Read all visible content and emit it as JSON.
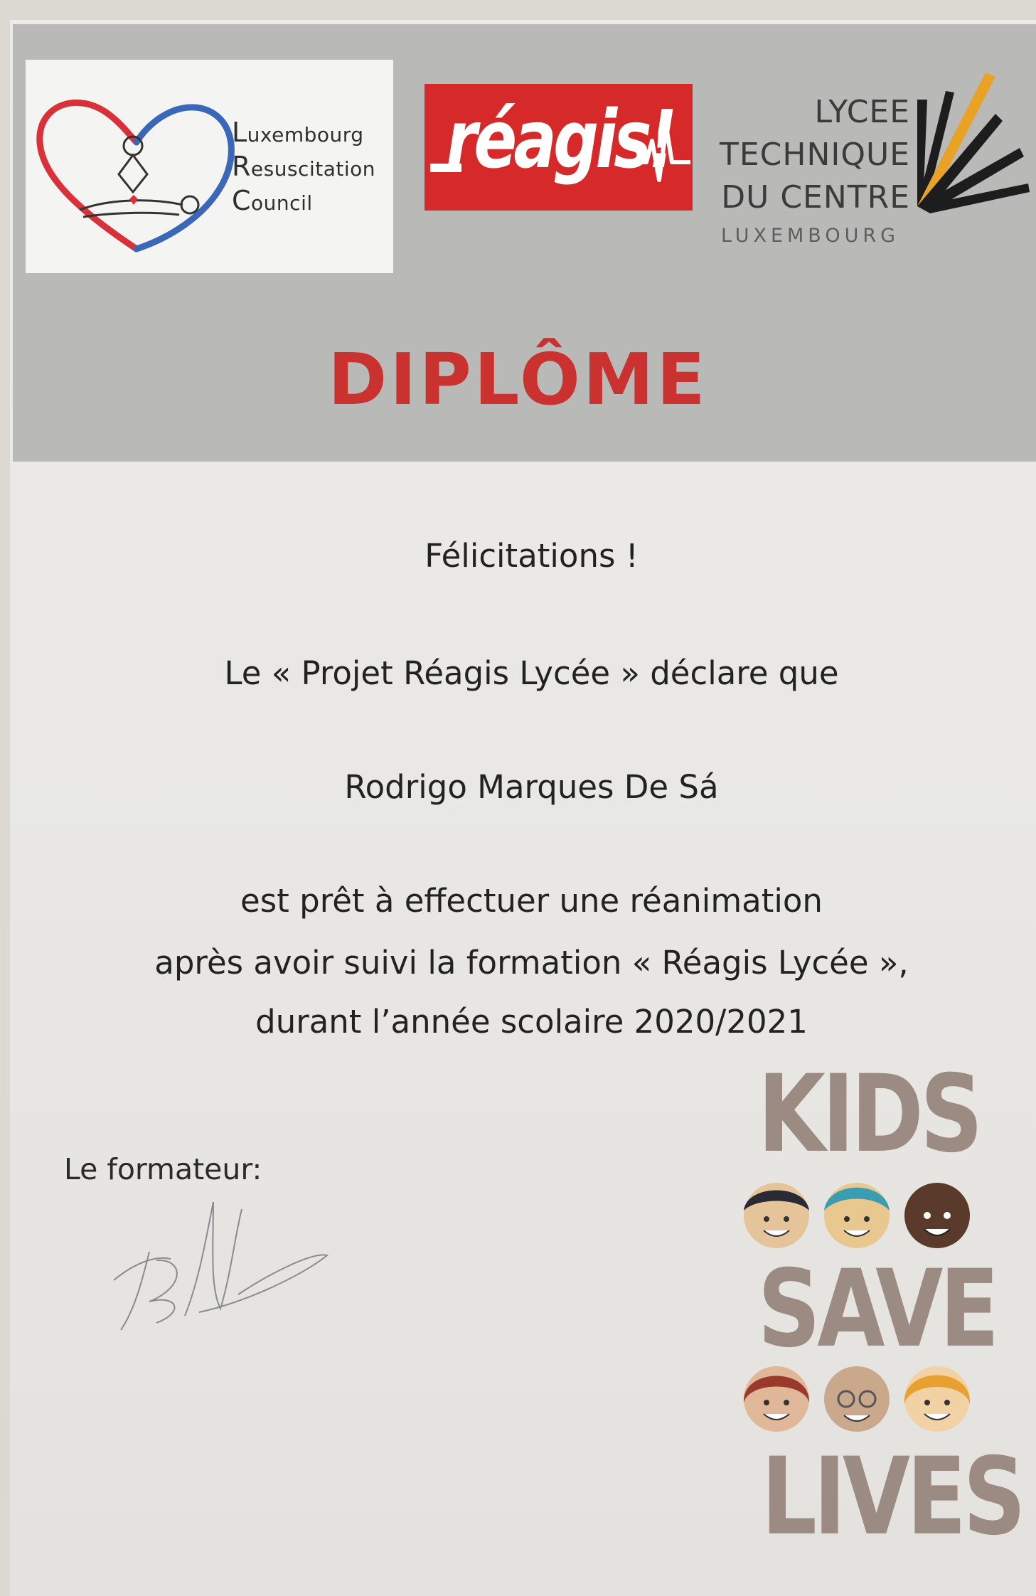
{
  "logos": {
    "lrc": {
      "line1": "Luxembourg",
      "line2": "Resuscitation",
      "line3": "Council"
    },
    "reagis": {
      "text": "réagis!"
    },
    "ltc": {
      "line1": "LYCEE",
      "line2": "TECHNIQUE",
      "line3": "DU CENTRE",
      "line4": "LUXEMBOURG"
    }
  },
  "certificate": {
    "title": "DIPLÔME",
    "greeting": "Félicitations !",
    "declaration": "Le « Projet Réagis Lycée » déclare que",
    "recipient": "Rodrigo Marques De Sá",
    "statement_line1": "est prêt à effectuer une réanimation",
    "statement_line2": "après avoir suivi la formation « Réagis Lycée »,",
    "statement_line3": "durant l’année scolaire 2020/2021",
    "trainer_label": "Le formateur:"
  },
  "campaign": {
    "word1": "KIDS",
    "word2": "SAVE",
    "word3": "LIVES"
  },
  "colors": {
    "accent_red": "#c9322f",
    "reagis_red": "#d62a2a",
    "ksl_brown": "#9c8b82",
    "band_gray": "#b9b9b8"
  }
}
